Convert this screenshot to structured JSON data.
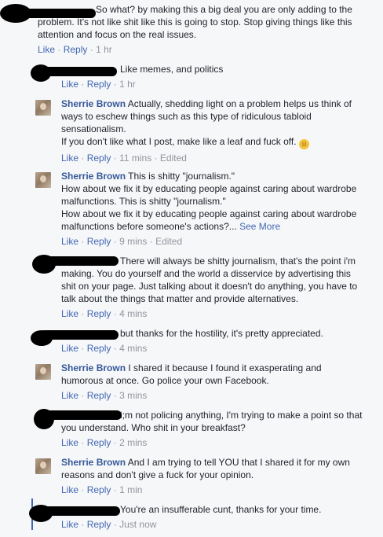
{
  "comments": [
    {
      "author": "",
      "text": "So what? by making this a big deal you are only adding to the problem. It's not like shit like this is going to stop. Stop giving things like this attention and focus on the real issues.",
      "like": "Like",
      "reply": "Reply",
      "time": "1 hr",
      "edited": ""
    },
    {
      "author": "",
      "text": "Like memes, and politics",
      "like": "Like",
      "reply": "Reply",
      "time": "1 hr",
      "edited": ""
    },
    {
      "author": "Sherrie Brown",
      "text": "Actually, shedding light on a problem helps us think of ways to eschew things such as this type of ridiculous tabloid sensationalism.",
      "text2": "If you don't like what I post, make like a leaf and fuck off.",
      "emoji": "smile-emoji",
      "like": "Like",
      "reply": "Reply",
      "time": "11 mins",
      "edited": "Edited"
    },
    {
      "author": "Sherrie Brown",
      "text": "This is shitty \"journalism.\"",
      "text2": "How about we fix it by educating people against caring about wardrobe malfunctions. This is shitty \"journalism.\"",
      "text3": "How about we fix it by educating people against caring about wardrobe malfunctions before someone's actions?...",
      "see_more": "See More",
      "like": "Like",
      "reply": "Reply",
      "time": "9 mins",
      "edited": "Edited"
    },
    {
      "author": "",
      "text": "There will always be shitty journalism, that's the point i'm making. You do yourself and the world a disservice by advertising this shit on your page. Just talking about it doesn't do anything, you have to talk about the things that matter and provide alternatives.",
      "like": "Like",
      "reply": "Reply",
      "time": "4 mins",
      "edited": ""
    },
    {
      "author": "",
      "text": "but thanks for the hostility, it's pretty appreciated.",
      "like": "Like",
      "reply": "Reply",
      "time": "4 mins",
      "edited": ""
    },
    {
      "author": "Sherrie Brown",
      "text": "I shared it because I found it exasperating and humorous at once. Go police your own Facebook.",
      "like": "Like",
      "reply": "Reply",
      "time": "3 mins",
      "edited": ""
    },
    {
      "author": "",
      "text": "i;m not policing anything, I'm trying to make a point so that you understand. Who shit in your breakfast?",
      "like": "Like",
      "reply": "Reply",
      "time": "2 mins",
      "edited": ""
    },
    {
      "author": "Sherrie Brown",
      "text": "And I am trying to tell YOU that I shared it for my own reasons and don't give a fuck for your opinion.",
      "like": "Like",
      "reply": "Reply",
      "time": "1 min",
      "edited": ""
    },
    {
      "author": "",
      "text": "You're an insufferable cunt, thanks for your time.",
      "like": "Like",
      "reply": "Reply",
      "time": "Just now",
      "edited": ""
    }
  ],
  "separator": "·",
  "colors": {
    "link": "#4267b2",
    "author": "#365899",
    "meta": "#90949c",
    "text": "#1d2129",
    "background": "#f6f7f9",
    "redaction": "#000000"
  }
}
